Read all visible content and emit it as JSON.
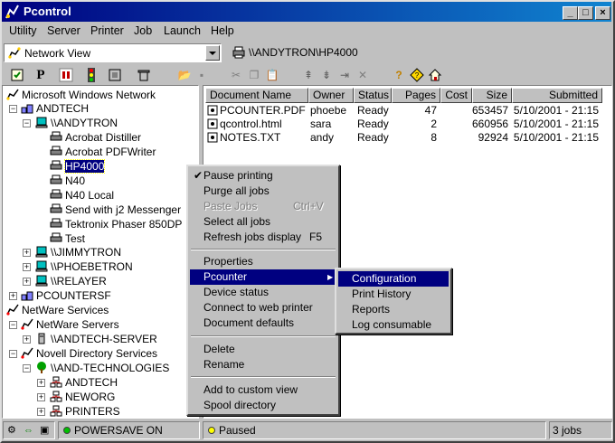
{
  "window": {
    "title": "Pcontrol"
  },
  "menubar": [
    "Utility",
    "Server",
    "Printer",
    "Job",
    "Launch",
    "Help"
  ],
  "view_combo": {
    "value": "Network View"
  },
  "current_path": "\\\\ANDYTRON\\HP4000",
  "tree": [
    "Microsoft Windows Network",
    "ANDTECH",
    "\\\\ANDYTRON",
    "Acrobat Distiller",
    "Acrobat PDFWriter",
    "HP4000",
    "N40",
    "N40 Local",
    "Send with j2 Messenger",
    "Tektronix Phaser 850DP",
    "Test",
    "\\\\JIMMYTRON",
    "\\\\PHOEBETRON",
    "\\\\RELAYER",
    "PCOUNTERSF",
    "NetWare Services",
    "NetWare Servers",
    "\\\\ANDTECH-SERVER",
    "Novell Directory Services",
    "\\\\AND-TECHNOLOGIES",
    "ANDTECH",
    "NEWORG",
    "PRINTERS"
  ],
  "jobs": {
    "columns": [
      "Document Name",
      "Owner",
      "Status",
      "Pages",
      "Cost",
      "Size",
      "Submitted"
    ],
    "rows": [
      [
        "PCOUNTER.PDF",
        "phoebe",
        "Ready",
        "47",
        "",
        "653457",
        "5/10/2001 - 21:15"
      ],
      [
        "qcontrol.html",
        "sara",
        "Ready",
        "2",
        "",
        "660956",
        "5/10/2001 - 21:15"
      ],
      [
        "NOTES.TXT",
        "andy",
        "Ready",
        "8",
        "",
        "92924",
        "5/10/2001 - 21:15"
      ]
    ]
  },
  "context_menu": {
    "pause": "Pause printing",
    "purge": "Purge all jobs",
    "paste": "Paste Jobs",
    "paste_shortcut": "Ctrl+V",
    "select_all": "Select all jobs",
    "refresh": "Refresh jobs display",
    "refresh_shortcut": "F5",
    "properties": "Properties",
    "pcounter": "Pcounter",
    "device_status": "Device status",
    "connect": "Connect to web printer",
    "doc_defaults": "Document defaults",
    "delete": "Delete",
    "rename": "Rename",
    "add_custom": "Add to custom view",
    "spool_dir": "Spool directory"
  },
  "submenu": {
    "configuration": "Configuration",
    "print_history": "Print History",
    "reports": "Reports",
    "log_consumable": "Log consumable"
  },
  "statusbar": {
    "powersave": "POWERSAVE ON",
    "queue_status": "Paused",
    "job_count": "3 jobs"
  },
  "colors": {
    "selection": "#000080",
    "powersave_dot": "#00c000",
    "paused_dot": "#ffff00"
  }
}
